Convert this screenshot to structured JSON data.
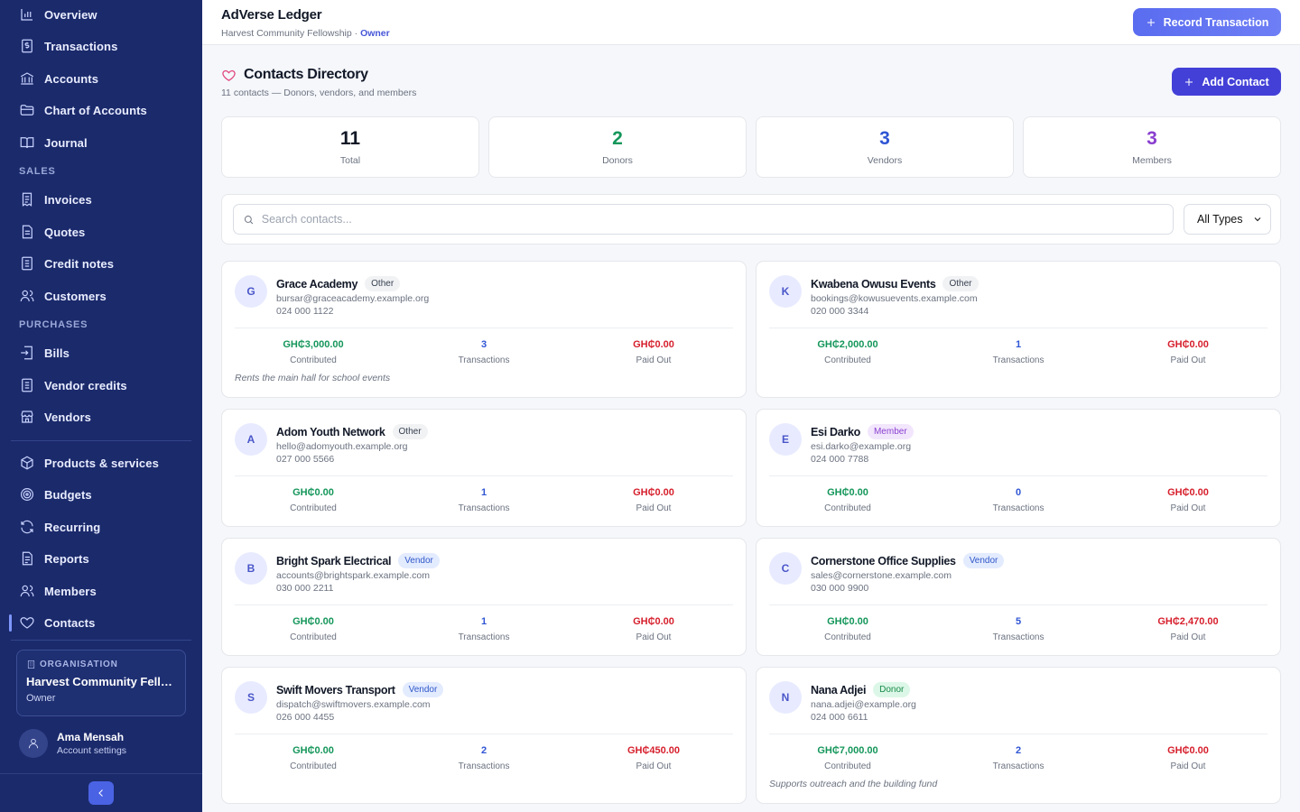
{
  "app": {
    "title": "AdVerse Ledger",
    "org_name": "Harvest Community Fellowship",
    "separator": " · ",
    "role": "Owner",
    "record_button": "Record Transaction"
  },
  "sidebar": {
    "items": [
      {
        "label": "Overview",
        "icon": "bar-chart-icon"
      },
      {
        "label": "Transactions",
        "icon": "dollar-doc-icon"
      },
      {
        "label": "Accounts",
        "icon": "bank-icon"
      },
      {
        "label": "Chart of Accounts",
        "icon": "folder-icon"
      },
      {
        "label": "Journal",
        "icon": "book-icon"
      }
    ],
    "sales_label": "SALES",
    "sales_items": [
      {
        "label": "Invoices",
        "icon": "invoice-icon"
      },
      {
        "label": "Quotes",
        "icon": "document-icon"
      },
      {
        "label": "Credit notes",
        "icon": "credit-note-icon"
      },
      {
        "label": "Customers",
        "icon": "users-icon"
      }
    ],
    "purchases_label": "PURCHASES",
    "purchase_items": [
      {
        "label": "Bills",
        "icon": "bill-icon"
      },
      {
        "label": "Vendor credits",
        "icon": "document-icon"
      },
      {
        "label": "Vendors",
        "icon": "store-icon"
      }
    ],
    "other_items": [
      {
        "label": "Products & services",
        "icon": "package-icon"
      },
      {
        "label": "Budgets",
        "icon": "target-icon"
      },
      {
        "label": "Recurring",
        "icon": "refresh-icon"
      },
      {
        "label": "Reports",
        "icon": "report-icon"
      },
      {
        "label": "Members",
        "icon": "users-icon"
      },
      {
        "label": "Contacts",
        "icon": "heart-icon",
        "active": true
      }
    ],
    "org_card": {
      "label": "ORGANISATION",
      "name": "Harvest Community Fello...",
      "role": "Owner"
    },
    "user": {
      "name": "Ama Mensah",
      "sub": "Account settings"
    }
  },
  "page": {
    "title": "Contacts Directory",
    "subtitle": "11 contacts — Donors, vendors, and members",
    "add_button": "Add Contact"
  },
  "stats": [
    {
      "value": "11",
      "label": "Total",
      "color": "#111827"
    },
    {
      "value": "2",
      "label": "Donors",
      "color": "#14965a"
    },
    {
      "value": "3",
      "label": "Vendors",
      "color": "#2f55d4"
    },
    {
      "value": "3",
      "label": "Members",
      "color": "#8a3fcf"
    }
  ],
  "filter": {
    "search_placeholder": "Search contacts...",
    "type_selected": "All Types"
  },
  "stat_labels": {
    "contributed": "Contributed",
    "transactions": "Transactions",
    "paid_out": "Paid Out"
  },
  "contacts": [
    {
      "initial": "G",
      "name": "Grace Academy",
      "type": "Other",
      "email": "bursar@graceacademy.example.org",
      "phone": "024 000 1122",
      "contributed": "GH₵3,000.00",
      "transactions": "3",
      "paid_out": "GH₵0.00",
      "note": "Rents the main hall for school events"
    },
    {
      "initial": "K",
      "name": "Kwabena Owusu Events",
      "type": "Other",
      "email": "bookings@kowusuevents.example.com",
      "phone": "020 000 3344",
      "contributed": "GH₵2,000.00",
      "transactions": "1",
      "paid_out": "GH₵0.00",
      "note": ""
    },
    {
      "initial": "A",
      "name": "Adom Youth Network",
      "type": "Other",
      "email": "hello@adomyouth.example.org",
      "phone": "027 000 5566",
      "contributed": "GH₵0.00",
      "transactions": "1",
      "paid_out": "GH₵0.00",
      "note": ""
    },
    {
      "initial": "E",
      "name": "Esi Darko",
      "type": "Member",
      "email": "esi.darko@example.org",
      "phone": "024 000 7788",
      "contributed": "GH₵0.00",
      "transactions": "0",
      "paid_out": "GH₵0.00",
      "note": ""
    },
    {
      "initial": "B",
      "name": "Bright Spark Electrical",
      "type": "Vendor",
      "email": "accounts@brightspark.example.com",
      "phone": "030 000 2211",
      "contributed": "GH₵0.00",
      "transactions": "1",
      "paid_out": "GH₵0.00",
      "note": ""
    },
    {
      "initial": "C",
      "name": "Cornerstone Office Supplies",
      "type": "Vendor",
      "email": "sales@cornerstone.example.com",
      "phone": "030 000 9900",
      "contributed": "GH₵0.00",
      "transactions": "5",
      "paid_out": "GH₵2,470.00",
      "note": ""
    },
    {
      "initial": "S",
      "name": "Swift Movers Transport",
      "type": "Vendor",
      "email": "dispatch@swiftmovers.example.com",
      "phone": "026 000 4455",
      "contributed": "GH₵0.00",
      "transactions": "2",
      "paid_out": "GH₵450.00",
      "note": ""
    },
    {
      "initial": "N",
      "name": "Nana Adjei",
      "type": "Donor",
      "email": "nana.adjei@example.org",
      "phone": "024 000 6611",
      "contributed": "GH₵7,000.00",
      "transactions": "2",
      "paid_out": "GH₵0.00",
      "note": "Supports outreach and the building fund"
    }
  ]
}
